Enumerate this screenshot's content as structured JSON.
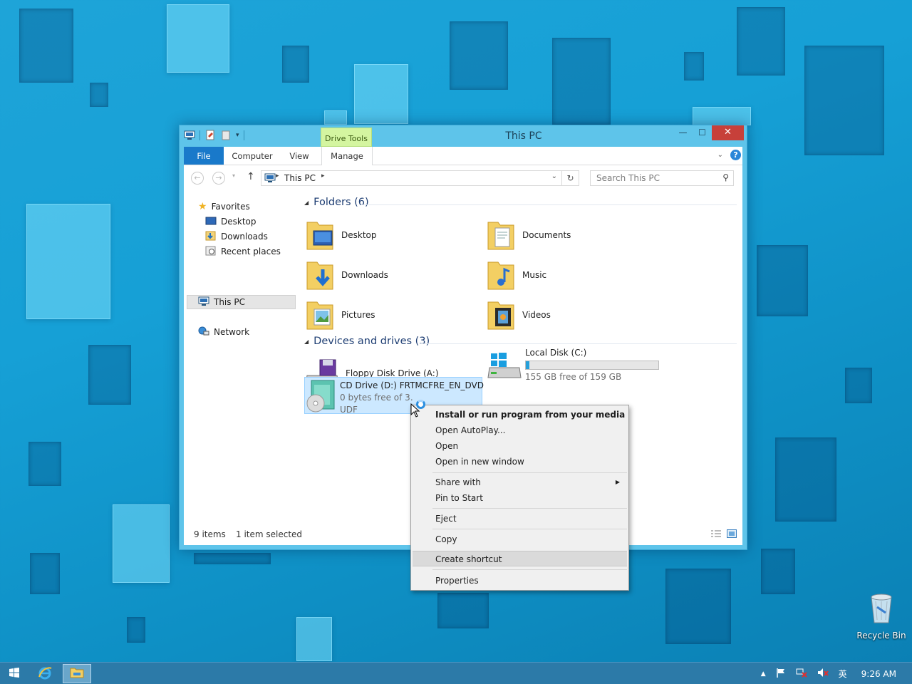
{
  "window": {
    "title": "This PC",
    "context_tab": "Drive Tools",
    "controls": {
      "minimize": "—",
      "maximize": "☐",
      "close": "✕"
    }
  },
  "ribbon": {
    "tabs": [
      {
        "label": "File"
      },
      {
        "label": "Computer"
      },
      {
        "label": "View"
      },
      {
        "label": "Manage"
      }
    ],
    "help": "?"
  },
  "address": {
    "crumbs": [
      "This PC"
    ],
    "search_placeholder": "Search This PC"
  },
  "nav": {
    "favorites": "Favorites",
    "desktop": "Desktop",
    "downloads": "Downloads",
    "recent": "Recent places",
    "this_pc": "This PC",
    "network": "Network"
  },
  "folders": {
    "header": "Folders (6)",
    "items": [
      {
        "label": "Desktop",
        "icon": "desktop-folder-icon"
      },
      {
        "label": "Documents",
        "icon": "documents-folder-icon"
      },
      {
        "label": "Downloads",
        "icon": "downloads-folder-icon"
      },
      {
        "label": "Music",
        "icon": "music-folder-icon"
      },
      {
        "label": "Pictures",
        "icon": "pictures-folder-icon"
      },
      {
        "label": "Videos",
        "icon": "videos-folder-icon"
      }
    ]
  },
  "drives": {
    "header": "Devices and drives (3)",
    "floppy": {
      "name": "Floppy Disk Drive (A:)"
    },
    "local": {
      "name": "Local Disk (C:)",
      "free": "155 GB free of 159 GB",
      "used_fraction": 0.025
    },
    "cd": {
      "name": "CD Drive (D:) FRTMCFRE_EN_DVD",
      "free": "0 bytes free of 3.",
      "fs": "UDF"
    }
  },
  "status": {
    "count": "9 items",
    "selected": "1 item selected"
  },
  "context_menu": {
    "items": [
      "Install or run program from your media",
      "Open AutoPlay...",
      "Open",
      "Open in new window",
      "Share with",
      "Pin to Start",
      "Eject",
      "Copy",
      "Create shortcut",
      "Properties"
    ]
  },
  "desktop": {
    "recycle_bin": "Recycle Bin"
  },
  "taskbar": {
    "ime": "英",
    "clock": "9:26 AM"
  },
  "colors": {
    "accent": "#1979ca",
    "selection": "#cce8ff",
    "close": "#c7403a",
    "drive_tools": "#d4f5a0"
  }
}
